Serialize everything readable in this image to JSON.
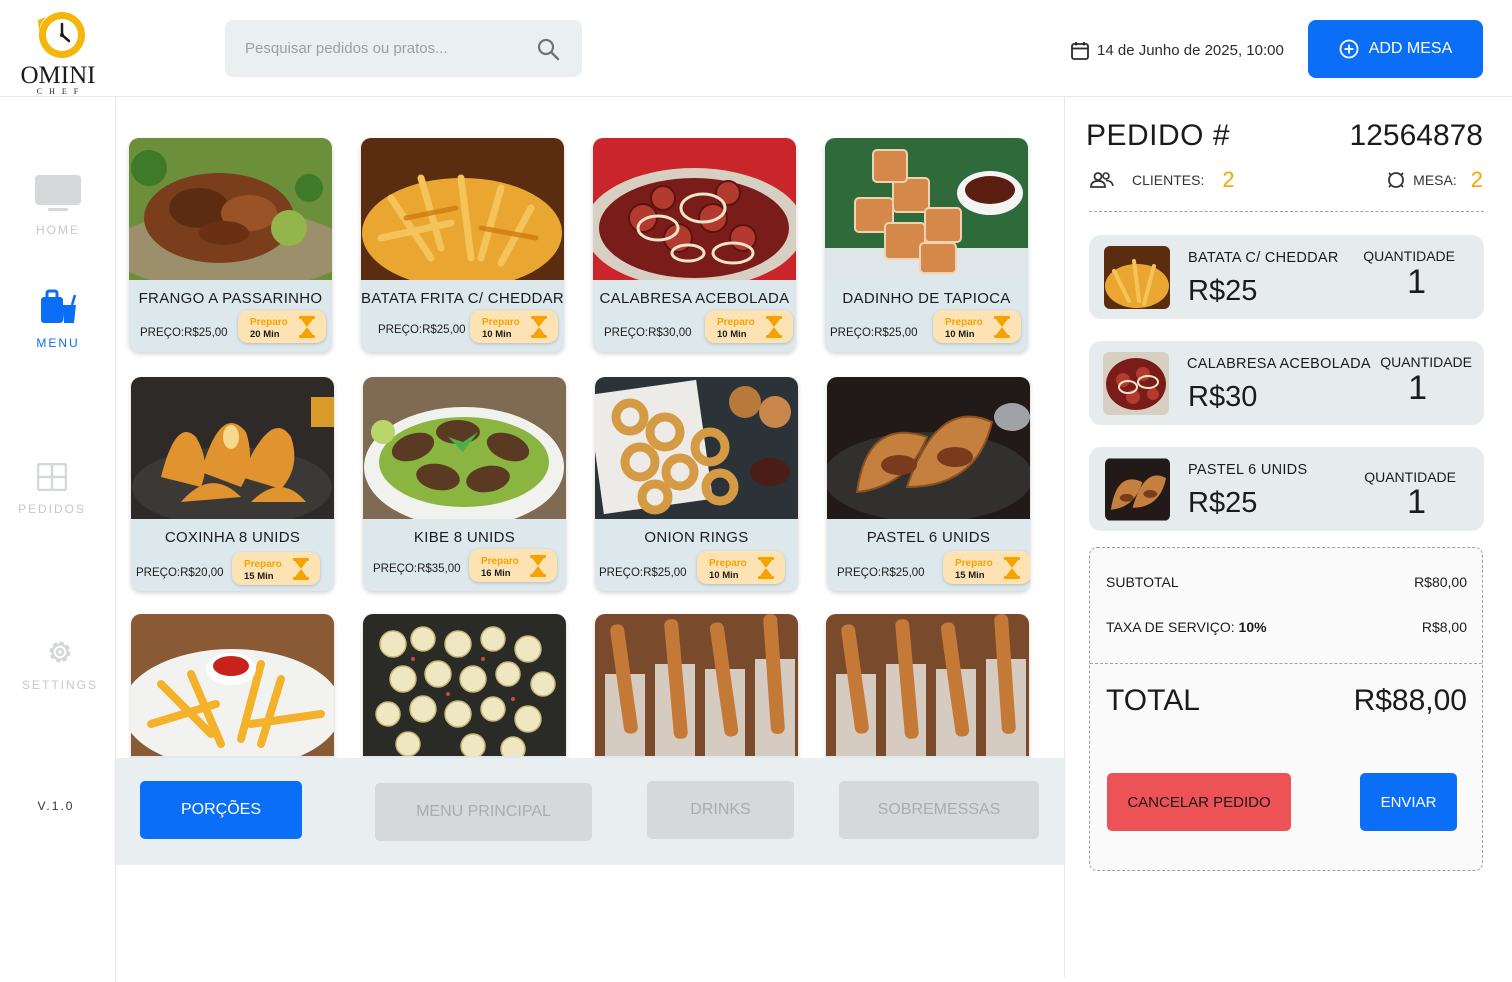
{
  "brand": {
    "name": "OMINI",
    "sub": "CHEF"
  },
  "search": {
    "placeholder": "Pesquisar pedidos ou pratos..."
  },
  "header": {
    "date": "14 de Junho de 2025, 10:00",
    "add_button": "ADD MESA"
  },
  "colors": {
    "accent": "#0a6ef7",
    "warning": "#f5a800",
    "danger": "#ec5256",
    "card_bg": "#dde8ec"
  },
  "sidebar": {
    "items": [
      {
        "label": "HOME",
        "icon": "monitor-icon",
        "active": false
      },
      {
        "label": "MENU",
        "icon": "menu-bag-icon",
        "active": true
      },
      {
        "label": "PEDIDOS",
        "icon": "grid-icon",
        "active": false
      },
      {
        "label": "SETTINGS",
        "icon": "gear-icon",
        "active": false
      }
    ],
    "version": "V.1.0"
  },
  "menu": {
    "prep_label": "Preparo",
    "items": [
      {
        "name": "FRANGO  A PASSARINHO",
        "price": "PREÇO:R$25,00",
        "prep": "20 Min"
      },
      {
        "name": "BATATA FRITA C/ CHEDDAR",
        "price": "PREÇO:R$25,00",
        "prep": "10 Min"
      },
      {
        "name": "CALABRESA ACEBOLADA",
        "price": "PREÇO:R$30,00",
        "prep": "10 Min"
      },
      {
        "name": "DADINHO DE TAPIOCA",
        "price": "PREÇO:R$25,00",
        "prep": "10 Min"
      },
      {
        "name": "COXINHA 8 UNIDS",
        "price": "PREÇO:R$20,00",
        "prep": "15 Min"
      },
      {
        "name": "KIBE 8 UNIDS",
        "price": "PREÇO:R$35,00",
        "prep": "16 Min"
      },
      {
        "name": "ONION RINGS",
        "price": "PREÇO:R$25,00",
        "prep": "10 Min"
      },
      {
        "name": "PASTEL 6 UNIDS",
        "price": "PREÇO:R$25,00",
        "prep": "15 Min"
      },
      {
        "name": "",
        "price": "",
        "prep": ""
      },
      {
        "name": "",
        "price": "",
        "prep": ""
      },
      {
        "name": "",
        "price": "",
        "prep": ""
      },
      {
        "name": "",
        "price": "",
        "prep": ""
      }
    ]
  },
  "categories": [
    {
      "label": "PORÇÕES",
      "active": true
    },
    {
      "label": "MENU PRINCIPAL",
      "active": false
    },
    {
      "label": "DRINKS",
      "active": false
    },
    {
      "label": "SOBREMESSAS",
      "active": false
    }
  ],
  "order": {
    "title": "PEDIDO #",
    "number": "12564878",
    "clients_label": "CLIENTES:",
    "clients": "2",
    "table_label": "MESA:",
    "table": "2",
    "qty_label": "QUANTIDADE",
    "items": [
      {
        "name": "BATATA C/ CHEDDAR",
        "price": "R$25",
        "qty": "1"
      },
      {
        "name": "CALABRESA ACEBOLADA",
        "price": "R$30",
        "qty": "1"
      },
      {
        "name": "PASTEL 6 UNIDS",
        "price": "R$25",
        "qty": "1"
      }
    ],
    "subtotal_label": "SUBTOTAL",
    "subtotal": "R$80,00",
    "service_label": "TAXA DE SERVIÇO:",
    "service_pct": "10%",
    "service": "R$8,00",
    "total_label": "TOTAL",
    "total": "R$88,00",
    "cancel_label": "CANCELAR PEDIDO",
    "send_label": "ENVIAR"
  }
}
